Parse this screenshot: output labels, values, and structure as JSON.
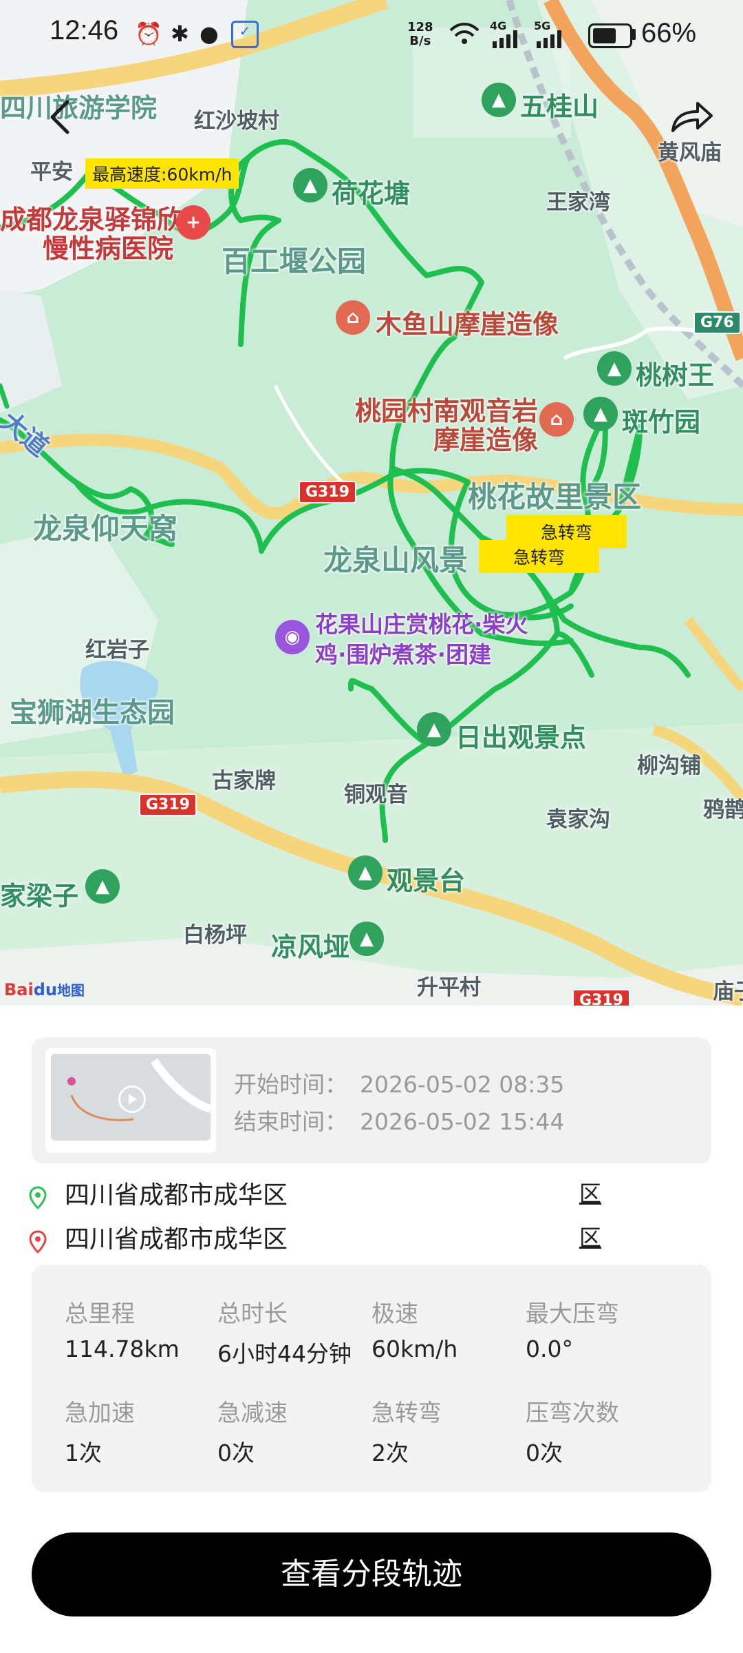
{
  "status_bar": {
    "time": "12:46",
    "net_speed_value": "128",
    "net_speed_unit": "B/s",
    "network_4g": "4G",
    "network_5g": "5G",
    "battery_percent": "66%",
    "battery_level": 0.66,
    "icons": [
      "alarm-icon",
      "bluetooth-icon",
      "location-icon",
      "app-icon",
      "wifi-icon",
      "signal-icon",
      "battery-icon"
    ]
  },
  "map": {
    "labels": {
      "sichuan_tourism": "四川旅游学院",
      "hongshapo": "红沙坡村",
      "wuguishan": "五桂山",
      "huangfengmiao": "黄风庙",
      "pingan": "平安",
      "hehuatang": "荷花塘",
      "wangjiawan": "王家湾",
      "hospital_line1": "成都龙泉驿锦欣",
      "hospital_line2": "慢性病医院",
      "baigongyan": "百工堰公园",
      "muyushan": "木鱼山摩崖造像",
      "taoshuwang": "桃树王",
      "taoyuan_line1": "桃园村南观音岩",
      "taoyuan_line2": "摩崖造像",
      "banzhuyuan": "斑竹园",
      "taohua_scenic": "桃花故里景区",
      "dadao": "大道",
      "longquan_tianwo": "龙泉仰天窝",
      "longquanshan": "龙泉山风景",
      "huaguoshan_line1": "花果山庄赏桃花·柴火",
      "huaguoshan_line2": "鸡·围炉煮茶·团建",
      "hongyanzi": "红岩子",
      "baoshihu": "宝狮湖生态园",
      "richu": "日出观景点",
      "liugoupu": "柳沟铺",
      "gujiapai": "古家牌",
      "tongguanyin": "铜观音",
      "yuanjiagou": "袁家沟",
      "yabu": "鸦鹊",
      "jialiangzi": "家梁子",
      "guanjingtai": "观景台",
      "baiyangping": "白杨坪",
      "liangfengya": "凉风垭",
      "shengpingcun": "升平村",
      "miao": "庙子"
    },
    "route_shields": {
      "g76": "G76",
      "g319_a": "G319",
      "g319_b": "G319",
      "g319_c": "G319"
    },
    "max_speed_tag": "最高速度:60km/h",
    "sharp_turn_tag": "急转弯",
    "sharp_turn_tag2": "急转弯",
    "logo": {
      "bai": "Bai",
      "du": "du",
      "ditu": "地图"
    },
    "colors": {
      "track": "#1fbf4f",
      "park": "#c6ecd3",
      "highway": "#f5d37a"
    }
  },
  "trip": {
    "start_label": "开始时间：",
    "start_value": "2026-05-02 08:35",
    "end_label": "结束时间：",
    "end_value": "2026-05-02 15:44",
    "start_address": "四川省成都市成华区",
    "start_address_tail": "区",
    "end_address": "四川省成都市成华区",
    "end_address_tail": "区"
  },
  "stats": [
    {
      "label": "总里程",
      "value": "114.78km"
    },
    {
      "label": "总时长",
      "value": "6小时44分钟"
    },
    {
      "label": "极速",
      "value": "60km/h"
    },
    {
      "label": "最大压弯",
      "value": "0.0°"
    },
    {
      "label": "急加速",
      "value": "1次"
    },
    {
      "label": "急减速",
      "value": "0次"
    },
    {
      "label": "急转弯",
      "value": "2次"
    },
    {
      "label": "压弯次数",
      "value": "0次"
    }
  ],
  "actions": {
    "segment_button": "查看分段轨迹"
  }
}
